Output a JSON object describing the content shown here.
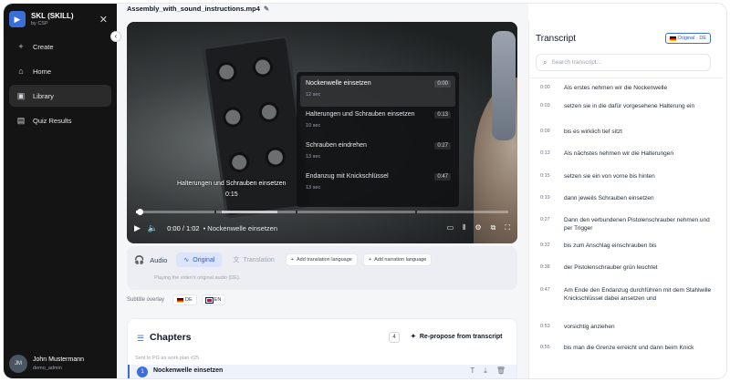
{
  "sidebar": {
    "brand_name": "SKL (SKILL)",
    "brand_sub": "by CSP",
    "nav": [
      {
        "label": "Create",
        "icon": "plus-icon"
      },
      {
        "label": "Home",
        "icon": "home-icon"
      },
      {
        "label": "Library",
        "icon": "library-icon",
        "active": true
      },
      {
        "label": "Quiz Results",
        "icon": "chart-icon"
      }
    ],
    "user": {
      "initials": "JM",
      "name": "John Mustermann",
      "role": "demo_admin"
    }
  },
  "main": {
    "file_title": "Assembly_with_sound_instructions.mp4",
    "video": {
      "chapter_menu": [
        {
          "title": "Nockenwelle einsetzen",
          "duration": "12 sec",
          "time": "0:00",
          "active": true
        },
        {
          "title": "Halterungen und Schrauben einsetzen",
          "duration": "10 sec",
          "time": "0:13"
        },
        {
          "title": "Schrauben eindrehen",
          "duration": "13 sec",
          "time": "0:27"
        },
        {
          "title": "Endanzug mit Knickschlüssel",
          "duration": "13 sec",
          "time": "0:47"
        }
      ],
      "hover_chapter": "Halterungen und Schrauben einsetzen",
      "hover_time": "0:15",
      "current_time": "0:00 / 1:02",
      "current_chapter": "• Nockenwelle einsetzen",
      "progress_percent": 1,
      "buffer_percent": 38,
      "hover_percent": 23
    },
    "audio": {
      "label": "Audio",
      "original_label": "Original",
      "translation_label": "Translation",
      "add_translation": "Add translation language",
      "add_narration": "Add narration language",
      "description": "Playing the video's original audio (DE)."
    },
    "subtitles": {
      "label": "Subtitle overlay",
      "options": [
        "DE",
        "EN"
      ]
    },
    "chapters": {
      "title": "Chapters",
      "count": "4",
      "repropose_label": "Re-propose from transcript",
      "sent_note": "Sent to PG as work plan #25",
      "first": {
        "num": "1",
        "name": "Nockenwelle einsetzen"
      }
    }
  },
  "transcript": {
    "title": "Transcript",
    "badge": "Original · DE",
    "search_placeholder": "Search transcript...",
    "rows": [
      {
        "time": "0:00",
        "text": "Als erstes nehmen wir die Nockenwelle"
      },
      {
        "time": "0:03",
        "text": "setzen sie in die dafür vorgesehene Halterung ein"
      },
      {
        "time": "0:09",
        "text": "bis es wirklich tief sitzt"
      },
      {
        "time": "0:13",
        "text": "Als nächstes nehmen wir die Halterungen"
      },
      {
        "time": "0:15",
        "text": "setzen sie ein von vorne bis hinten"
      },
      {
        "time": "0:19",
        "text": "dann jeweils Schrauben einsetzen"
      },
      {
        "time": "0:27",
        "text": "Dann den verbundenen Pistolenschrauber nehmen und per Trigger"
      },
      {
        "time": "0:32",
        "text": "bis zum Anschlag einschrauben bis"
      },
      {
        "time": "0:38",
        "text": "der Pistolenschrauber grün leuchtet"
      },
      {
        "time": "0:47",
        "text": "Am Ende den Endanzug durchführen mit dem Stahlwille Knickschlüssel dabei ansetzen und"
      },
      {
        "time": "0:53",
        "text": "vorsichtig anziehen"
      },
      {
        "time": "0:55",
        "text": "bis man die Grenze erreicht und dann beim Knick"
      }
    ]
  },
  "colors": {
    "accent": "#3b6fd8",
    "sidebar_bg": "#141414"
  }
}
